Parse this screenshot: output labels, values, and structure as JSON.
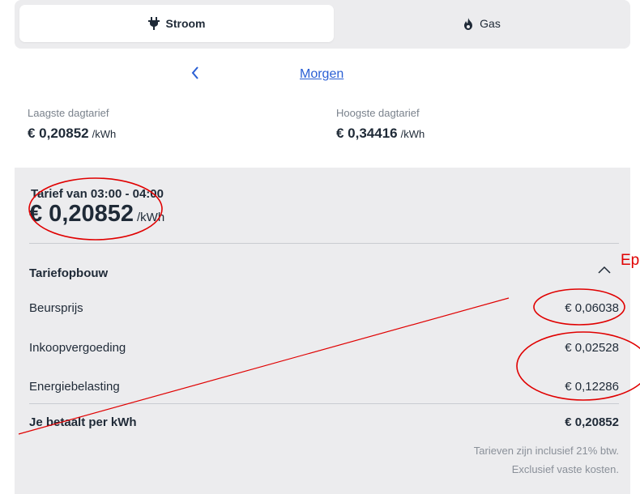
{
  "tabs": {
    "stroom": "Stroom",
    "gas": "Gas"
  },
  "nav": {
    "period": "Morgen"
  },
  "stats": {
    "low_label": "Laagste dagtarief",
    "low_value": "€ 0,20852",
    "low_unit": "/kWh",
    "high_label": "Hoogste dagtarief",
    "high_value": "€ 0,34416",
    "high_unit": "/kWh"
  },
  "detail": {
    "range": "Tarief van 03:00 - 04:00",
    "price": "€ 0,20852",
    "unit": "/kWh",
    "breakdown_title": "Tariefopbouw",
    "rows": [
      {
        "label": "Beursprijs",
        "value": "€ 0,06038"
      },
      {
        "label": "Inkoopvergoeding",
        "value": "€ 0,02528"
      },
      {
        "label": "Energiebelasting",
        "value": "€ 0,12286"
      }
    ],
    "total_label": "Je betaalt per kWh",
    "total_value": "€ 0,20852",
    "note_line1": "Tarieven zijn inclusief 21% btw.",
    "note_line2": "Exclusief vaste kosten."
  },
  "annotation": {
    "text": "Ep",
    "color": "#e00000"
  }
}
